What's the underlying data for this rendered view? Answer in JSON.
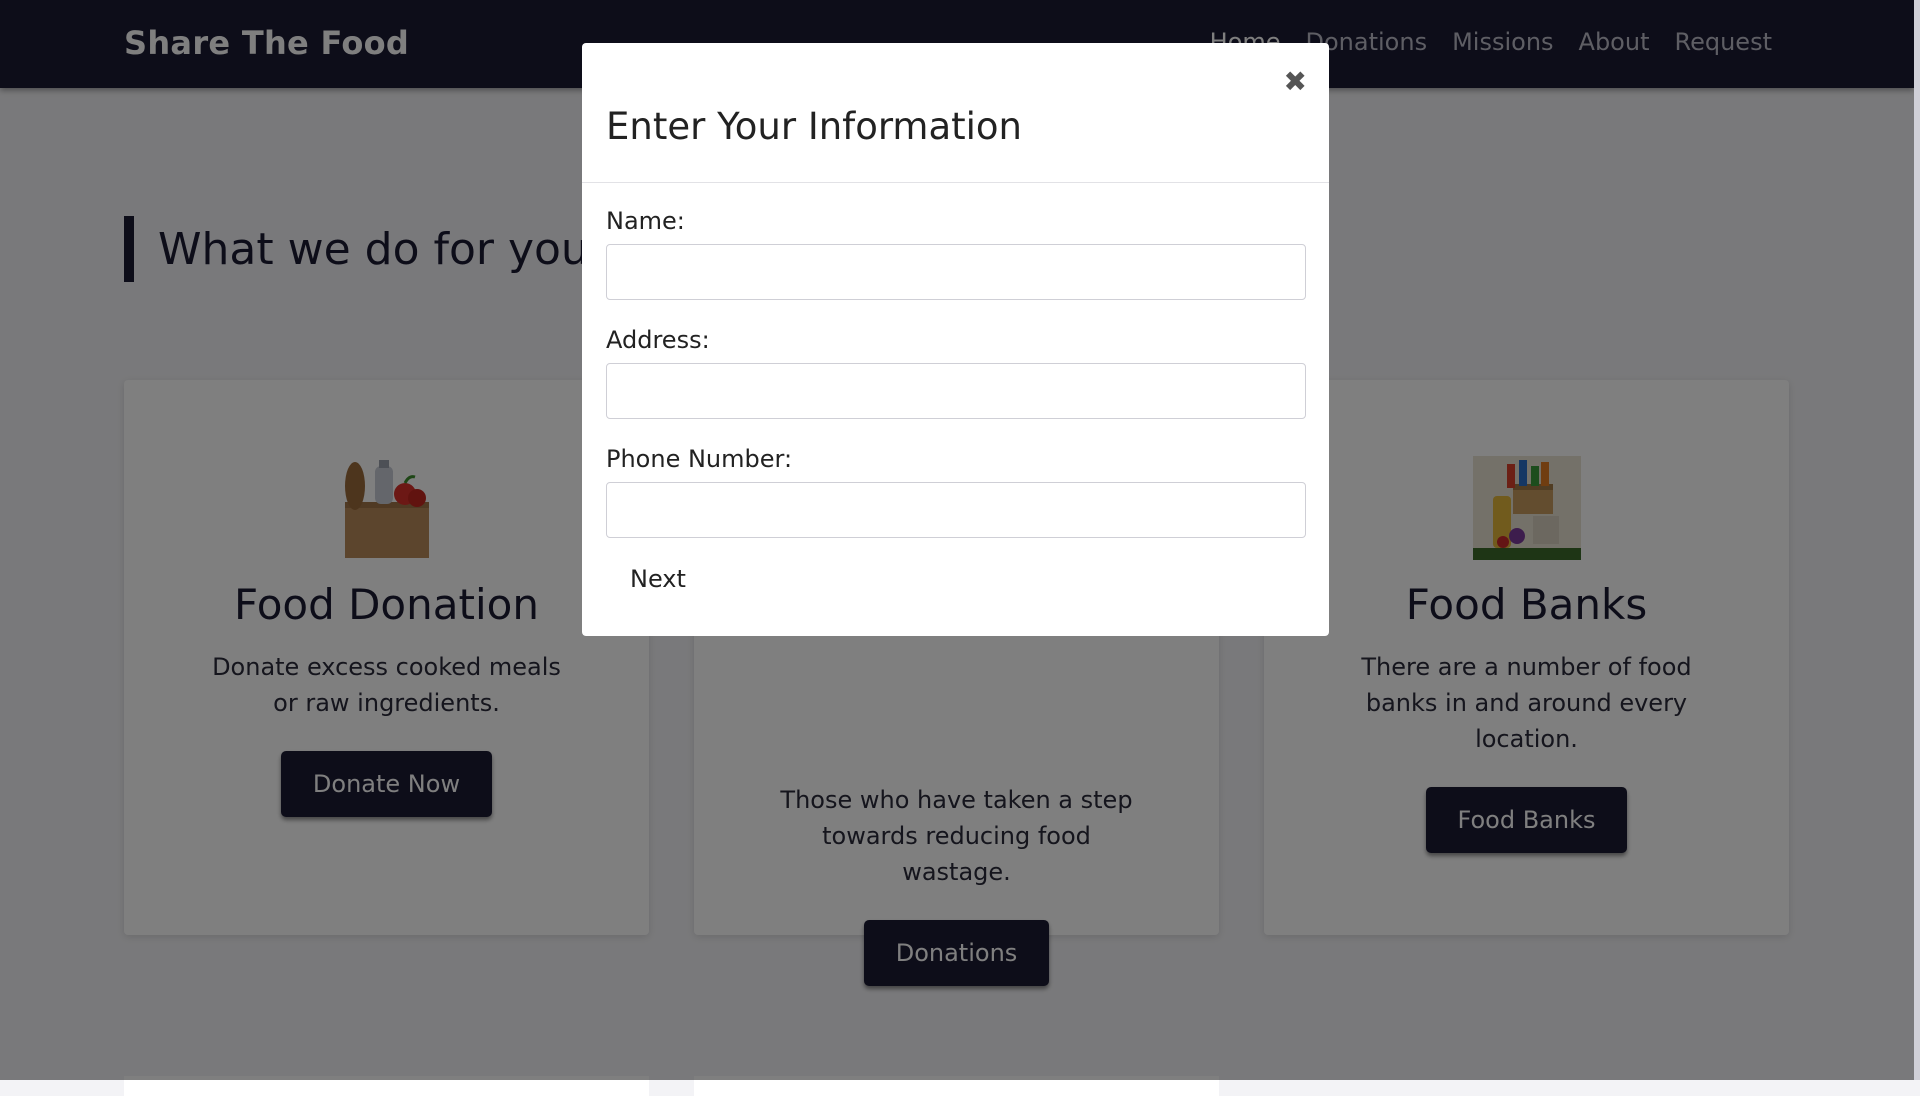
{
  "navbar": {
    "brand": "Share The Food",
    "links": [
      {
        "label": "Home"
      },
      {
        "label": "Donations"
      },
      {
        "label": "Missions"
      },
      {
        "label": "About"
      },
      {
        "label": "Request"
      }
    ]
  },
  "section": {
    "heading": "What we do for you.."
  },
  "cards": [
    {
      "title": "Food Donation",
      "description": "Donate excess cooked meals or raw ingredients.",
      "button": "Donate Now",
      "icon": "grocery-bag-icon"
    },
    {
      "title": "",
      "description": "Those who have taken a step towards reducing food wastage.",
      "button": "Donations",
      "icon": "donations-icon"
    },
    {
      "title": "Food Banks",
      "description": "There are a number of food banks in and around every location.",
      "button": "Food Banks",
      "icon": "food-box-icon"
    }
  ],
  "modal": {
    "title": "Enter Your Information",
    "close_symbol": "✖",
    "fields": [
      {
        "label": "Name:",
        "value": ""
      },
      {
        "label": "Address:",
        "value": ""
      },
      {
        "label": "Phone Number:",
        "value": ""
      }
    ],
    "next_label": "Next"
  },
  "colors": {
    "navbar": "#1b1a33",
    "button": "#1b1a33",
    "overlay": "rgba(0,0,0,0.5)"
  }
}
